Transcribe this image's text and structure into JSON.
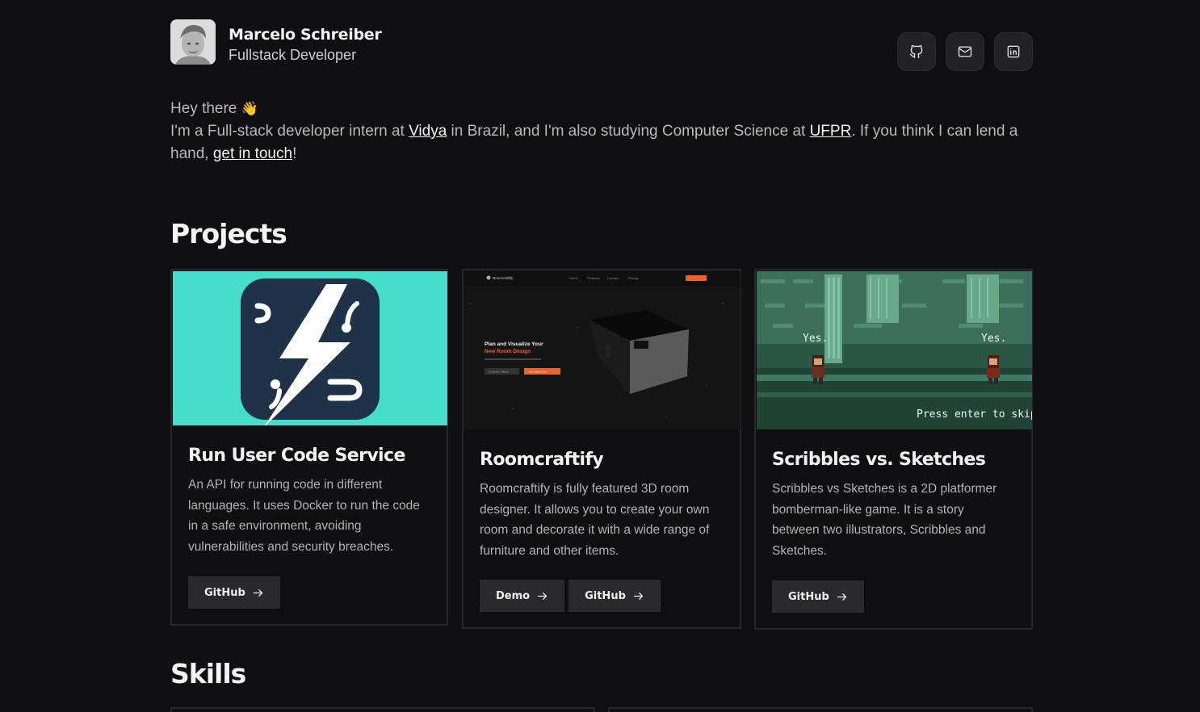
{
  "profile": {
    "name": "Marcelo Schreiber",
    "role": "Fullstack Developer"
  },
  "social": [
    {
      "icon": "github-icon"
    },
    {
      "icon": "mail-icon"
    },
    {
      "icon": "linkedin-icon"
    }
  ],
  "intro": {
    "greeting": "Hey there",
    "wave": "👋",
    "line_part1": "I'm a Full-stack developer intern at ",
    "link_company": "Vidya",
    "line_part2": " in Brazil, and I'm also studying Computer Science at ",
    "link_university": "UFPR",
    "line_part3": ". If you think I can lend a hand, ",
    "link_contact": "get in touch",
    "line_end": "!"
  },
  "projects": {
    "title": "Projects",
    "items": [
      {
        "title": "Run User Code Service",
        "description": "An API for running code in different languages. It uses Docker to run the code in a safe environment, avoiding vulnerabilities and security breaches.",
        "buttons": [
          "GitHub"
        ]
      },
      {
        "title": "Roomcraftify",
        "description": "Roomcraftify is fully featured 3D room designer. It allows you to create your own room and decorate it with a wide range of furniture and other items.",
        "buttons": [
          "Demo",
          "GitHub"
        ],
        "preview": {
          "brand": "Roomcraftify",
          "nav": [
            "Home",
            "Features",
            "Contact",
            "Pricing"
          ],
          "headline_1": "Plan and Visualize Your",
          "headline_2": "New Room Design",
          "cta_1": "Try Demo / Github",
          "cta_2": "Get Started Free"
        }
      },
      {
        "title": "Scribbles vs. Sketches",
        "description": "Scribbles vs Sketches is a 2D platformer bomberman-like game. It is a story between two illustrators, Scribbles and Sketches.",
        "buttons": [
          "GitHub"
        ],
        "preview": {
          "bubble_left": "Yes.",
          "bubble_right": "Yes.",
          "prompt": "Press enter to skip..."
        }
      }
    ]
  },
  "skills": {
    "title": "Skills"
  },
  "colors": {
    "background": "#0f0e10",
    "card_border": "#27262a",
    "button": "#2a292c",
    "teal": "#45dcc9",
    "logo_navy": "#1e3348",
    "orange": "#e8642c"
  }
}
